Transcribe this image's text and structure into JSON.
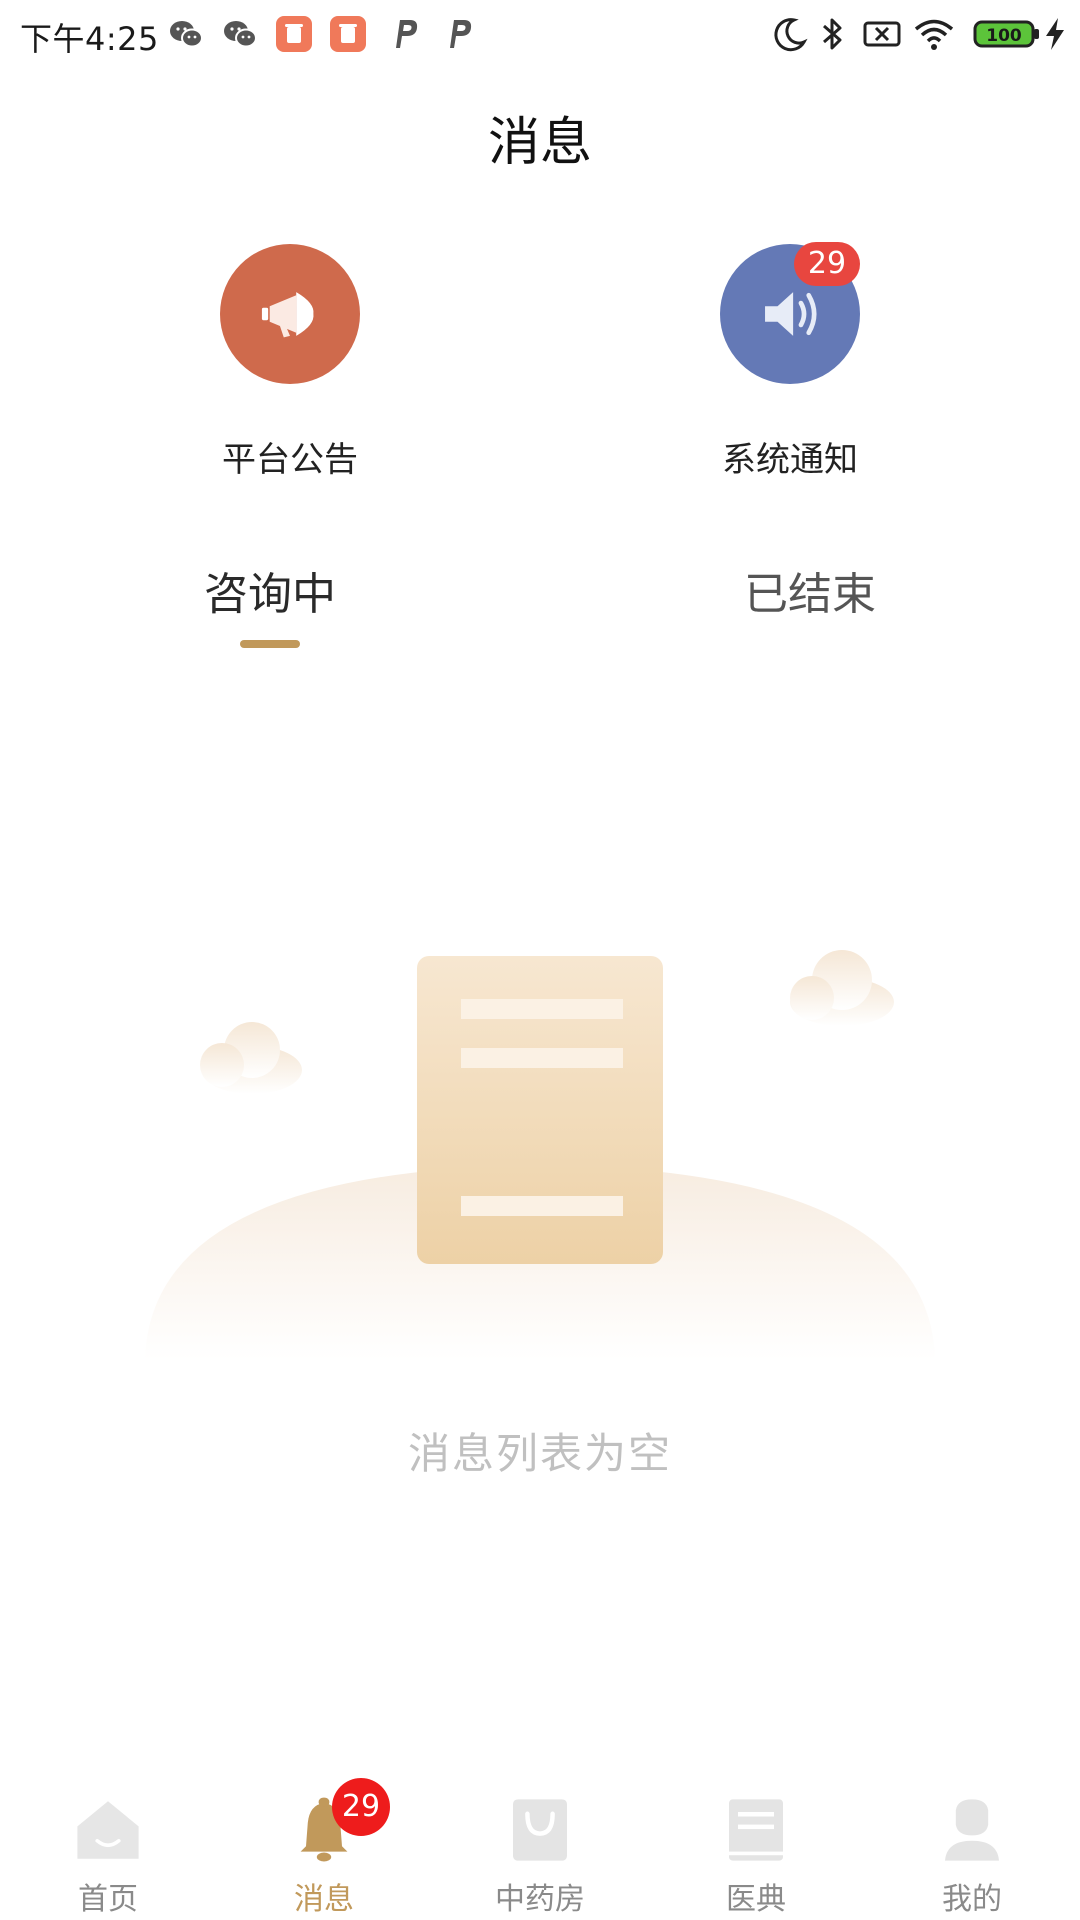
{
  "status_bar": {
    "time": "下午4:25",
    "battery": "100",
    "icons": [
      "wechat-icon",
      "wechat-icon",
      "app-icon",
      "app-icon",
      "p-icon",
      "p-icon",
      "moon-icon",
      "bluetooth-icon",
      "no-sim-icon",
      "wifi-icon",
      "battery-icon",
      "charging-icon"
    ]
  },
  "header": {
    "title": "消息"
  },
  "shortcuts": [
    {
      "label": "平台公告",
      "icon": "megaphone-icon",
      "color": "#cf6a4c"
    },
    {
      "label": "系统通知",
      "icon": "speaker-icon",
      "color": "#6479b6",
      "badge": "29"
    }
  ],
  "tabs": [
    {
      "label": "咨询中",
      "active": true
    },
    {
      "label": "已结束",
      "active": false
    }
  ],
  "empty": {
    "text": "消息列表为空"
  },
  "bottom_nav": {
    "items": [
      {
        "label": "首页",
        "icon": "home-icon",
        "active": false
      },
      {
        "label": "消息",
        "icon": "bell-icon",
        "active": true,
        "badge": "29"
      },
      {
        "label": "中药房",
        "icon": "shopping-bag-icon",
        "active": false
      },
      {
        "label": "医典",
        "icon": "book-icon",
        "active": false
      },
      {
        "label": "我的",
        "icon": "user-icon",
        "active": false
      }
    ]
  },
  "colors": {
    "accent": "#c1995b",
    "badge_red": "#e8463f",
    "nav_badge_red": "#ee1c1c",
    "tab_indicator": "#c1995b"
  }
}
